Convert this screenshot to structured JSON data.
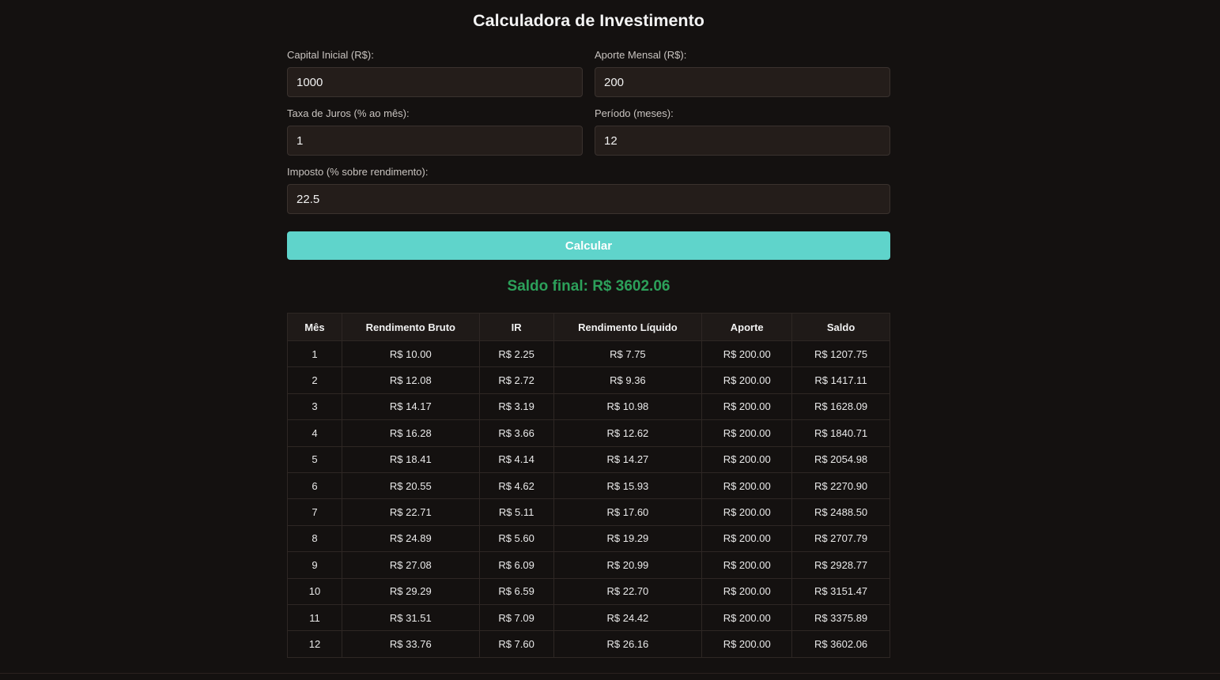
{
  "title": "Calculadora de Investimento",
  "fields": {
    "capital": {
      "label": "Capital Inicial (R$):",
      "value": "1000"
    },
    "aporte": {
      "label": "Aporte Mensal (R$):",
      "value": "200"
    },
    "taxa": {
      "label": "Taxa de Juros (% ao mês):",
      "value": "1"
    },
    "periodo": {
      "label": "Período (meses):",
      "value": "12"
    },
    "imposto": {
      "label": "Imposto (% sobre rendimento):",
      "value": "22.5"
    }
  },
  "button_label": "Calcular",
  "result_text": "Saldo final: R$ 3602.06",
  "colors": {
    "accent": "#5fd4cb",
    "result": "#2ca05a",
    "background": "#141110"
  },
  "table": {
    "headers": [
      "Mês",
      "Rendimento Bruto",
      "IR",
      "Rendimento Líquido",
      "Aporte",
      "Saldo"
    ],
    "rows": [
      [
        "1",
        "R$ 10.00",
        "R$ 2.25",
        "R$ 7.75",
        "R$ 200.00",
        "R$ 1207.75"
      ],
      [
        "2",
        "R$ 12.08",
        "R$ 2.72",
        "R$ 9.36",
        "R$ 200.00",
        "R$ 1417.11"
      ],
      [
        "3",
        "R$ 14.17",
        "R$ 3.19",
        "R$ 10.98",
        "R$ 200.00",
        "R$ 1628.09"
      ],
      [
        "4",
        "R$ 16.28",
        "R$ 3.66",
        "R$ 12.62",
        "R$ 200.00",
        "R$ 1840.71"
      ],
      [
        "5",
        "R$ 18.41",
        "R$ 4.14",
        "R$ 14.27",
        "R$ 200.00",
        "R$ 2054.98"
      ],
      [
        "6",
        "R$ 20.55",
        "R$ 4.62",
        "R$ 15.93",
        "R$ 200.00",
        "R$ 2270.90"
      ],
      [
        "7",
        "R$ 22.71",
        "R$ 5.11",
        "R$ 17.60",
        "R$ 200.00",
        "R$ 2488.50"
      ],
      [
        "8",
        "R$ 24.89",
        "R$ 5.60",
        "R$ 19.29",
        "R$ 200.00",
        "R$ 2707.79"
      ],
      [
        "9",
        "R$ 27.08",
        "R$ 6.09",
        "R$ 20.99",
        "R$ 200.00",
        "R$ 2928.77"
      ],
      [
        "10",
        "R$ 29.29",
        "R$ 6.59",
        "R$ 22.70",
        "R$ 200.00",
        "R$ 3151.47"
      ],
      [
        "11",
        "R$ 31.51",
        "R$ 7.09",
        "R$ 24.42",
        "R$ 200.00",
        "R$ 3375.89"
      ],
      [
        "12",
        "R$ 33.76",
        "R$ 7.60",
        "R$ 26.16",
        "R$ 200.00",
        "R$ 3602.06"
      ]
    ]
  }
}
